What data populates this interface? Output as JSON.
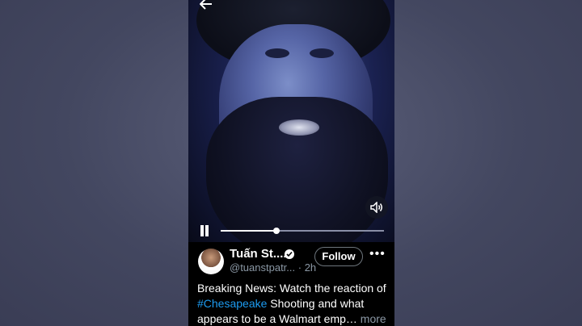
{
  "video": {
    "progress_fraction": 0.34
  },
  "author": {
    "display_name": "Tuấn St....",
    "handle": "@tuanstpatr...",
    "separator": " · ",
    "time_ago": "2h"
  },
  "follow_label": "Follow",
  "more_menu": "•••",
  "tweet": {
    "text_before": "Breaking News: Watch the reaction of ",
    "hashtag": "#Chesapeake",
    "text_after": " Shooting and what appears to be a Walmart emp…",
    "more_label": " more"
  },
  "colors": {
    "accent_link": "#1d9bf0",
    "secondary_text": "#8b98a5"
  }
}
